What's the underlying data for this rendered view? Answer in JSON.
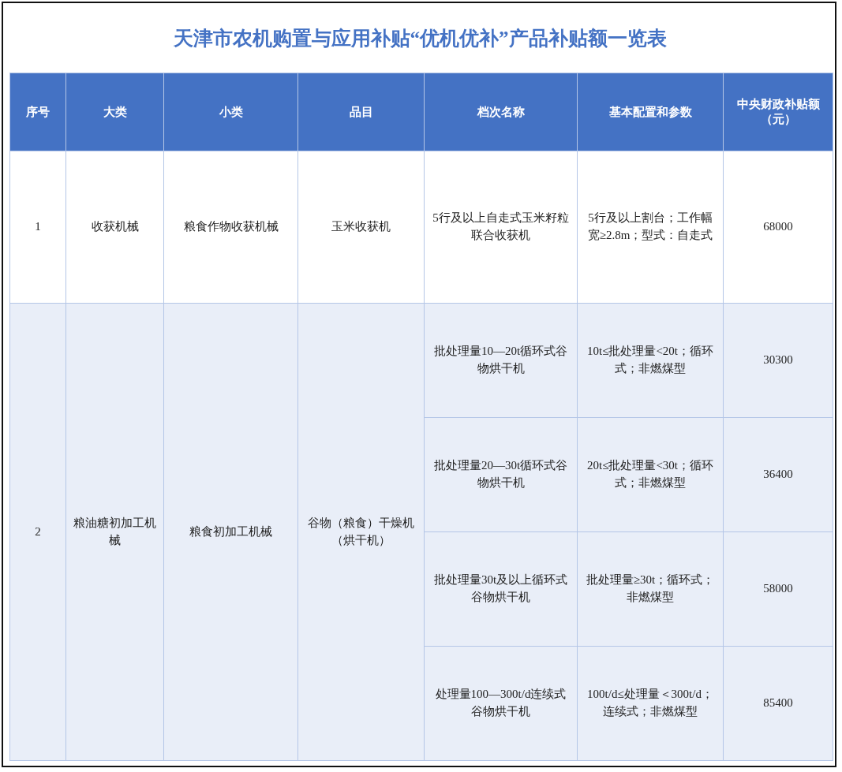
{
  "title": "天津市农机购置与应用补贴“优机优补”产品补贴额一览表",
  "table": {
    "columns": [
      "序号",
      "大类",
      "小类",
      "品目",
      "档次名称",
      "基本配置和参数",
      "中央财政补贴额（元）"
    ],
    "rows": [
      {
        "index": "1",
        "category": "收获机械",
        "subcategory": "粮食作物收获机械",
        "item": "玉米收获机",
        "grades": [
          {
            "name": "5行及以上自走式玉米籽粒联合收获机",
            "config": "5行及以上割台；工作幅宽≥2.8m；型式：自走式",
            "subsidy": "68000"
          }
        ]
      },
      {
        "index": "2",
        "category": "粮油糖初加工机械",
        "subcategory": "粮食初加工机械",
        "item": "谷物（粮食）干燥机（烘干机）",
        "grades": [
          {
            "name": "批处理量10—20t循环式谷物烘干机",
            "config": "10t≤批处理量<20t；循环式；非燃煤型",
            "subsidy": "30300"
          },
          {
            "name": "批处理量20—30t循环式谷物烘干机",
            "config": "20t≤批处理量<30t；循环式；非燃煤型",
            "subsidy": "36400"
          },
          {
            "name": "批处理量30t及以上循环式谷物烘干机",
            "config": "批处理量≥30t；循环式；非燃煤型",
            "subsidy": "58000"
          },
          {
            "name": "处理量100—300t/d连续式谷物烘干机",
            "config": "100t/d≤处理量＜300t/d；连续式；非燃煤型",
            "subsidy": "85400"
          }
        ]
      }
    ]
  }
}
